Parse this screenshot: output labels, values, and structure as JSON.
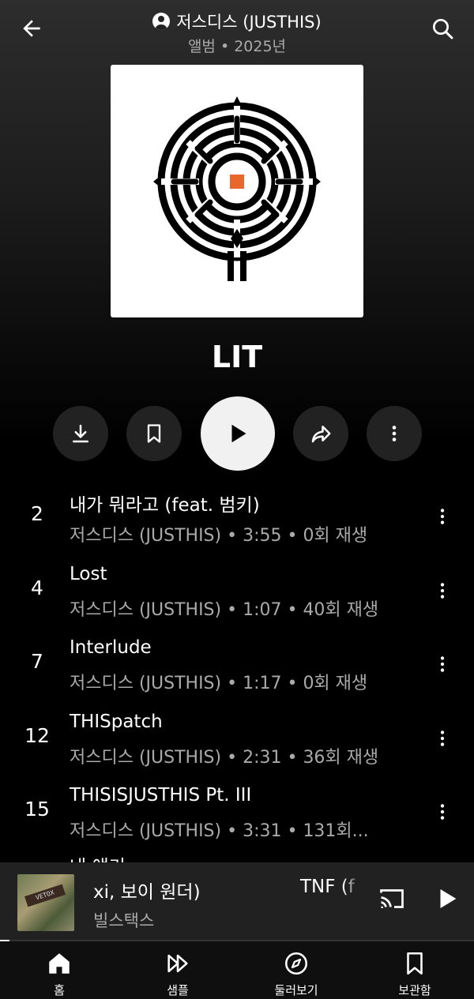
{
  "header": {
    "artist": "저스디스 (JUSTHIS)",
    "subline": "앨범 • 2025년"
  },
  "album": {
    "title": "LIT"
  },
  "tracks": [
    {
      "num": "2",
      "title": "내가 뭐라고 (feat. 범키)",
      "sub": "저스디스 (JUSTHIS) • 3:55 • 0회 재생"
    },
    {
      "num": "4",
      "title": "Lost",
      "sub": "저스디스 (JUSTHIS) • 1:07 • 40회 재생"
    },
    {
      "num": "7",
      "title": "Interlude",
      "sub": "저스디스 (JUSTHIS) • 1:17 • 0회 재생"
    },
    {
      "num": "12",
      "title": "THISpatch",
      "sub": "저스디스 (JUSTHIS) • 2:31 • 36회 재생"
    },
    {
      "num": "15",
      "title": "THISISJUSTHIS Pt. III",
      "sub": "저스디스 (JUSTHIS) • 3:31 • 131회..."
    }
  ],
  "partial_track": "내 얘기",
  "mini_player": {
    "title": "xi, 보이 원더)",
    "title_next": "TNF (f",
    "artist": "빌스택스",
    "thumb_text": "VETOX",
    "progress": 0.02
  },
  "nav": [
    {
      "label": "홈",
      "icon": "home-icon"
    },
    {
      "label": "샘플",
      "icon": "samples-icon"
    },
    {
      "label": "둘러보기",
      "icon": "explore-icon"
    },
    {
      "label": "보관함",
      "icon": "library-icon"
    }
  ],
  "colors": {
    "accent_orange": "#e8672a",
    "background": "#000000",
    "secondary_text": "#aaaaaa"
  }
}
